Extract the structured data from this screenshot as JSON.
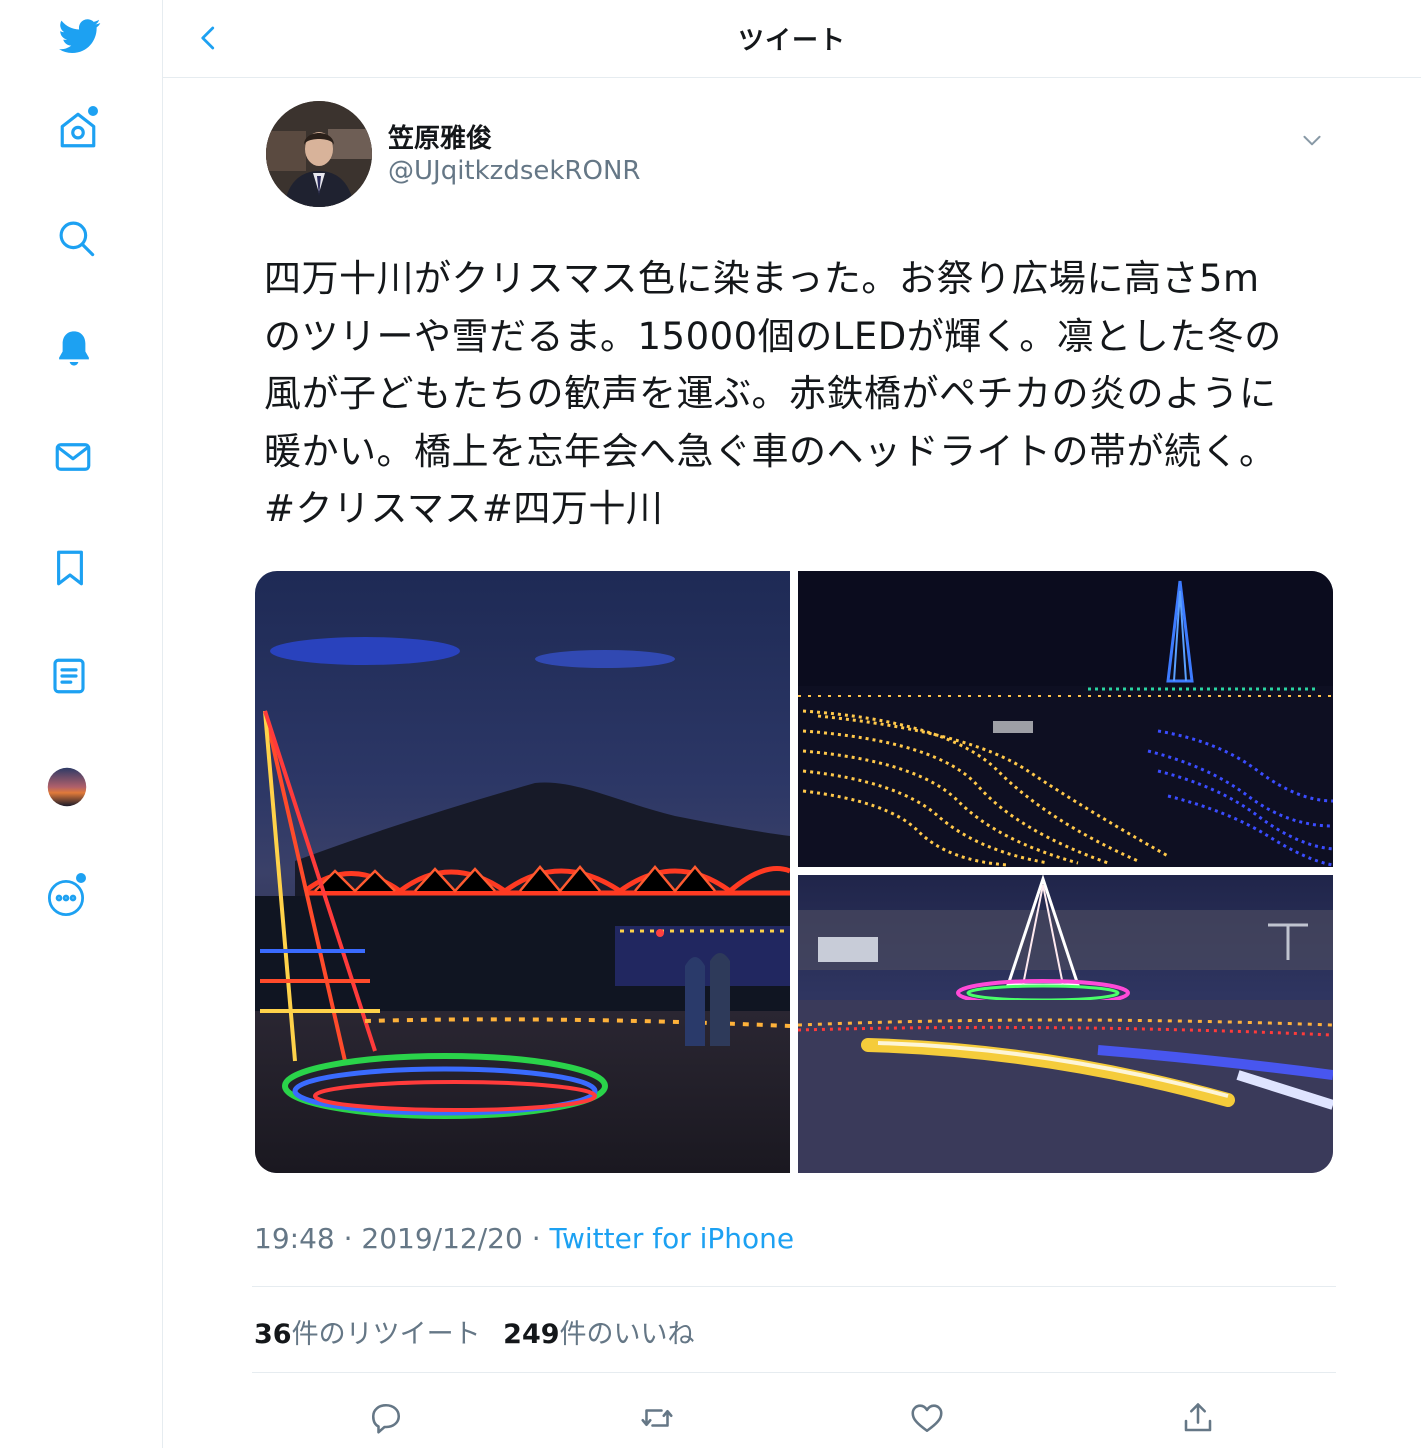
{
  "header": {
    "title": "ツイート"
  },
  "sidebar": {
    "items": [
      {
        "name": "twitter-logo-icon"
      },
      {
        "name": "home-icon",
        "has_dot": true
      },
      {
        "name": "search-icon"
      },
      {
        "name": "notifications-icon"
      },
      {
        "name": "messages-icon"
      },
      {
        "name": "bookmarks-icon"
      },
      {
        "name": "lists-icon"
      },
      {
        "name": "profile-avatar"
      },
      {
        "name": "more-icon",
        "has_dot": true
      }
    ]
  },
  "tweet": {
    "author": {
      "name": "笠原雅俊",
      "handle": "@UJqitkzdsekRONR"
    },
    "text_lines": [
      "四万十川がクリスマス色に染まった。お祭り広場に高さ5m",
      "のツリーや雪だるま。15000個のLEDが輝く。凛とした冬の",
      "風が子どもたちの歓声を運ぶ。赤鉄橋がペチカの炎のように",
      "暖かい。橋上を忘年会へ急ぐ車のヘッドライトの帯が続く。",
      "#クリスマス#四万十川"
    ],
    "time": "19:48",
    "date": "2019/12/20",
    "separator": " · ",
    "source": "Twitter for iPhone",
    "retweets_count": "36",
    "retweets_label": "件のリツイート",
    "likes_count": "249",
    "likes_label": "件のいいね"
  },
  "colors": {
    "accent": "#1da1f2",
    "secondary_text": "#657786",
    "border": "#e6ecf0"
  }
}
